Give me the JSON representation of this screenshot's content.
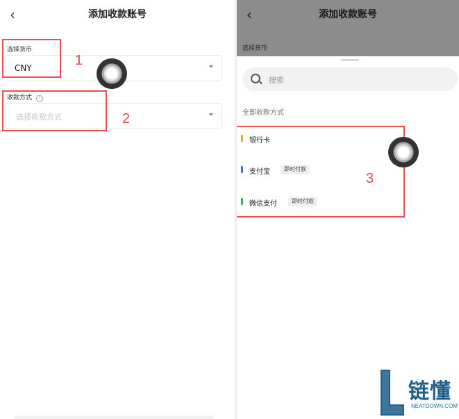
{
  "left": {
    "back_icon": "chevron-left-icon",
    "title": "添加收款账号",
    "currency_label": "选择货币",
    "currency_value": "CNY",
    "method_label": "收款方式",
    "method_info_icon": "info-circle-icon",
    "method_placeholder": "选择收款方式",
    "annotations": [
      "1",
      "2"
    ]
  },
  "right": {
    "back_icon": "chevron-left-icon",
    "title": "添加收款账号",
    "currency_label": "选择货币",
    "search_placeholder": "搜索",
    "section_title": "全部收款方式",
    "methods": [
      {
        "name": "银行卡",
        "badge": "",
        "color": "#f3a21c"
      },
      {
        "name": "支付宝",
        "badge": "即时付款",
        "color": "#3a6fd8"
      },
      {
        "name": "微信支付",
        "badge": "即时付款",
        "color": "#2dba5d"
      }
    ],
    "annotation": "3"
  },
  "watermark": {
    "text_cn": "链懂",
    "text_en": "NEATDOWN.COM"
  },
  "colors": {
    "annotation_red": "#ea4e4e",
    "overlay": "#8c8c8c"
  }
}
